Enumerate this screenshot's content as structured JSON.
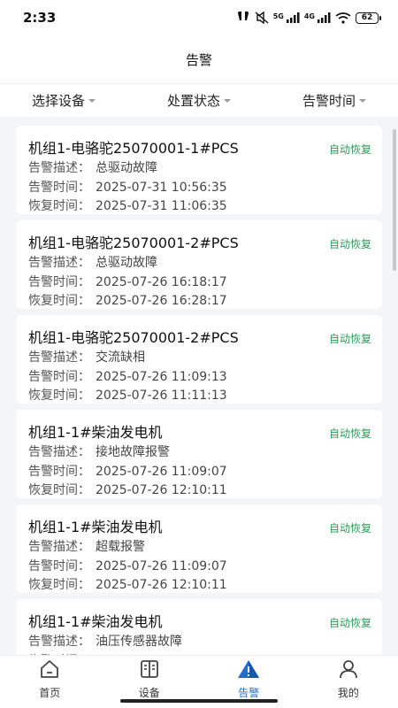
{
  "status_bar": {
    "time": "2:33",
    "network_5g": "5G",
    "network_4g": "4G",
    "battery": "62"
  },
  "header": {
    "title": "告警"
  },
  "filters": [
    {
      "label": "选择设备"
    },
    {
      "label": "处置状态"
    },
    {
      "label": "告警时间"
    }
  ],
  "labels": {
    "desc": "告警描述：",
    "alarm_time": "告警时间：",
    "recover_time": "恢复时间："
  },
  "alarms": [
    {
      "name": "机组1-电骆驼25070001-1#PCS",
      "status": "自动恢复",
      "desc": "总驱动故障",
      "alarm_time": "2025-07-31 10:56:35",
      "recover_time": "2025-07-31 11:06:35"
    },
    {
      "name": "机组1-电骆驼25070001-2#PCS",
      "status": "自动恢复",
      "desc": "总驱动故障",
      "alarm_time": "2025-07-26 16:18:17",
      "recover_time": "2025-07-26 16:28:17"
    },
    {
      "name": "机组1-电骆驼25070001-2#PCS",
      "status": "自动恢复",
      "desc": "交流缺相",
      "alarm_time": "2025-07-26 11:09:13",
      "recover_time": "2025-07-26 11:11:13"
    },
    {
      "name": "机组1-1#柴油发电机",
      "status": "自动恢复",
      "desc": "接地故障报警",
      "alarm_time": "2025-07-26 11:09:07",
      "recover_time": "2025-07-26 12:10:11"
    },
    {
      "name": "机组1-1#柴油发电机",
      "status": "自动恢复",
      "desc": "超载报警",
      "alarm_time": "2025-07-26 11:09:07",
      "recover_time": "2025-07-26 12:10:11"
    },
    {
      "name": "机组1-1#柴油发电机",
      "status": "自动恢复",
      "desc": "油压传感器故障",
      "alarm_time": "",
      "recover_time": ""
    }
  ],
  "tabs": [
    {
      "label": "首页",
      "icon": "home-icon"
    },
    {
      "label": "设备",
      "icon": "device-icon"
    },
    {
      "label": "告警",
      "icon": "alarm-icon"
    },
    {
      "label": "我的",
      "icon": "user-icon"
    }
  ],
  "colors": {
    "accent": "#1f6fd1",
    "status_ok": "#2e9a57"
  }
}
